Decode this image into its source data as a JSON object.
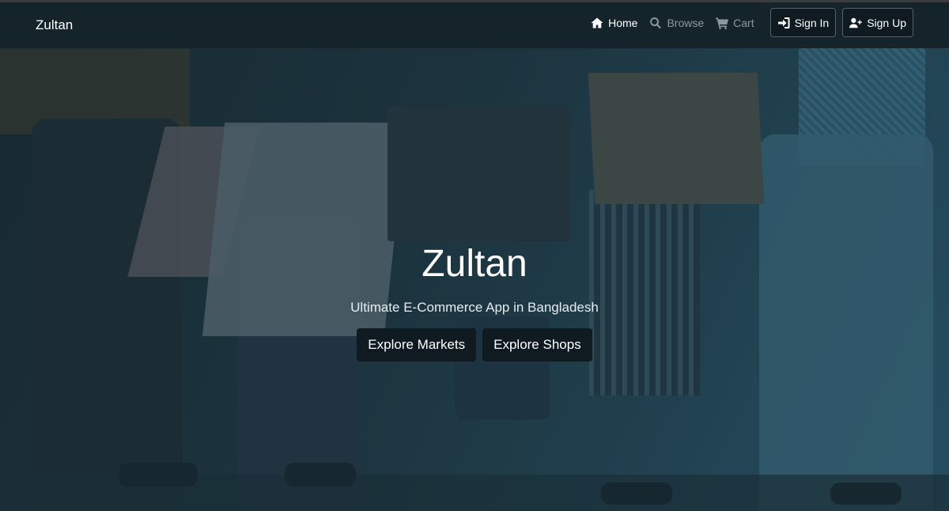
{
  "navbar": {
    "brand": "Zultan",
    "links": [
      {
        "label": "Home",
        "icon": "home-icon",
        "active": true
      },
      {
        "label": "Browse",
        "icon": "search-icon",
        "active": false
      },
      {
        "label": "Cart",
        "icon": "cart-icon",
        "active": false
      }
    ],
    "buttons": [
      {
        "label": "Sign In",
        "icon": "sign-in-icon"
      },
      {
        "label": "Sign Up",
        "icon": "user-plus-icon"
      }
    ]
  },
  "hero": {
    "title": "Zultan",
    "subtitle": "Ultimate E-Commerce App in Bangladesh",
    "actions": [
      {
        "label": "Explore Markets"
      },
      {
        "label": "Explore Shops"
      }
    ]
  },
  "colors": {
    "navbar_bg": "#15242b",
    "button_bg": "#101b21",
    "overlay_tint": "#1d3440",
    "link_inactive": "#8e979c"
  }
}
